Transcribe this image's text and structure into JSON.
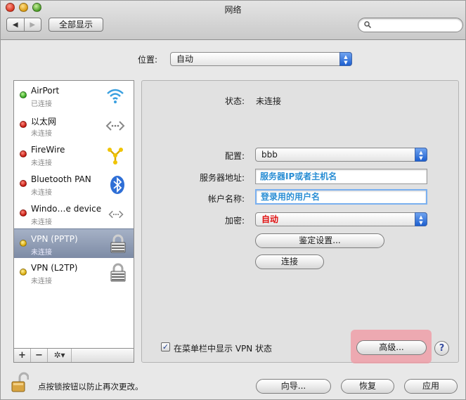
{
  "window": {
    "title": "网络"
  },
  "toolbar": {
    "show_all_label": "全部显示",
    "back_glyph": "◀",
    "forward_glyph": "▶"
  },
  "location": {
    "label": "位置:",
    "value": "自动"
  },
  "services": [
    {
      "name": "AirPort",
      "status": "已连接",
      "status_color": "green",
      "icon": "wifi-icon"
    },
    {
      "name": "以太网",
      "status": "未连接",
      "status_color": "red",
      "icon": "ethernet-icon"
    },
    {
      "name": "FireWire",
      "status": "未连接",
      "status_color": "red",
      "icon": "firewire-icon"
    },
    {
      "name": "Bluetooth PAN",
      "status": "未连接",
      "status_color": "red",
      "icon": "bluetooth-icon"
    },
    {
      "name": "Windo…e device",
      "status": "未连接",
      "status_color": "red",
      "icon": "ethernet-icon"
    },
    {
      "name": "VPN (PPTP)",
      "status": "未连接",
      "status_color": "yellow",
      "icon": "vpn-lock-icon",
      "selected": true
    },
    {
      "name": "VPN (L2TP)",
      "status": "未连接",
      "status_color": "yellow",
      "icon": "vpn-lock-icon"
    }
  ],
  "sidebar_controls": {
    "add": "+",
    "remove": "−",
    "gear": "✲▾"
  },
  "detail": {
    "status_label": "状态:",
    "status_value": "未连接",
    "config_label": "配置:",
    "config_value": "bbb",
    "server_label": "服务器地址:",
    "server_value": "服务器IP或者主机名",
    "account_label": "帐户名称:",
    "account_value": "登录用的用户名",
    "encryption_label": "加密:",
    "encryption_value": "自动",
    "auth_button": "鉴定设置...",
    "connect_button": "连接",
    "menubar_checkbox_label": "在菜单栏中显示 VPN 状态",
    "menubar_checked": true,
    "advanced_button": "高级...",
    "help_glyph": "?"
  },
  "footer": {
    "lock_text": "点按锁按钮以防止再次更改。",
    "assist_button": "向导...",
    "revert_button": "恢复",
    "apply_button": "应用"
  },
  "colors": {
    "input_text": "#2a8ed4",
    "encryption_text": "#e01010",
    "highlight": "#f096a0"
  }
}
